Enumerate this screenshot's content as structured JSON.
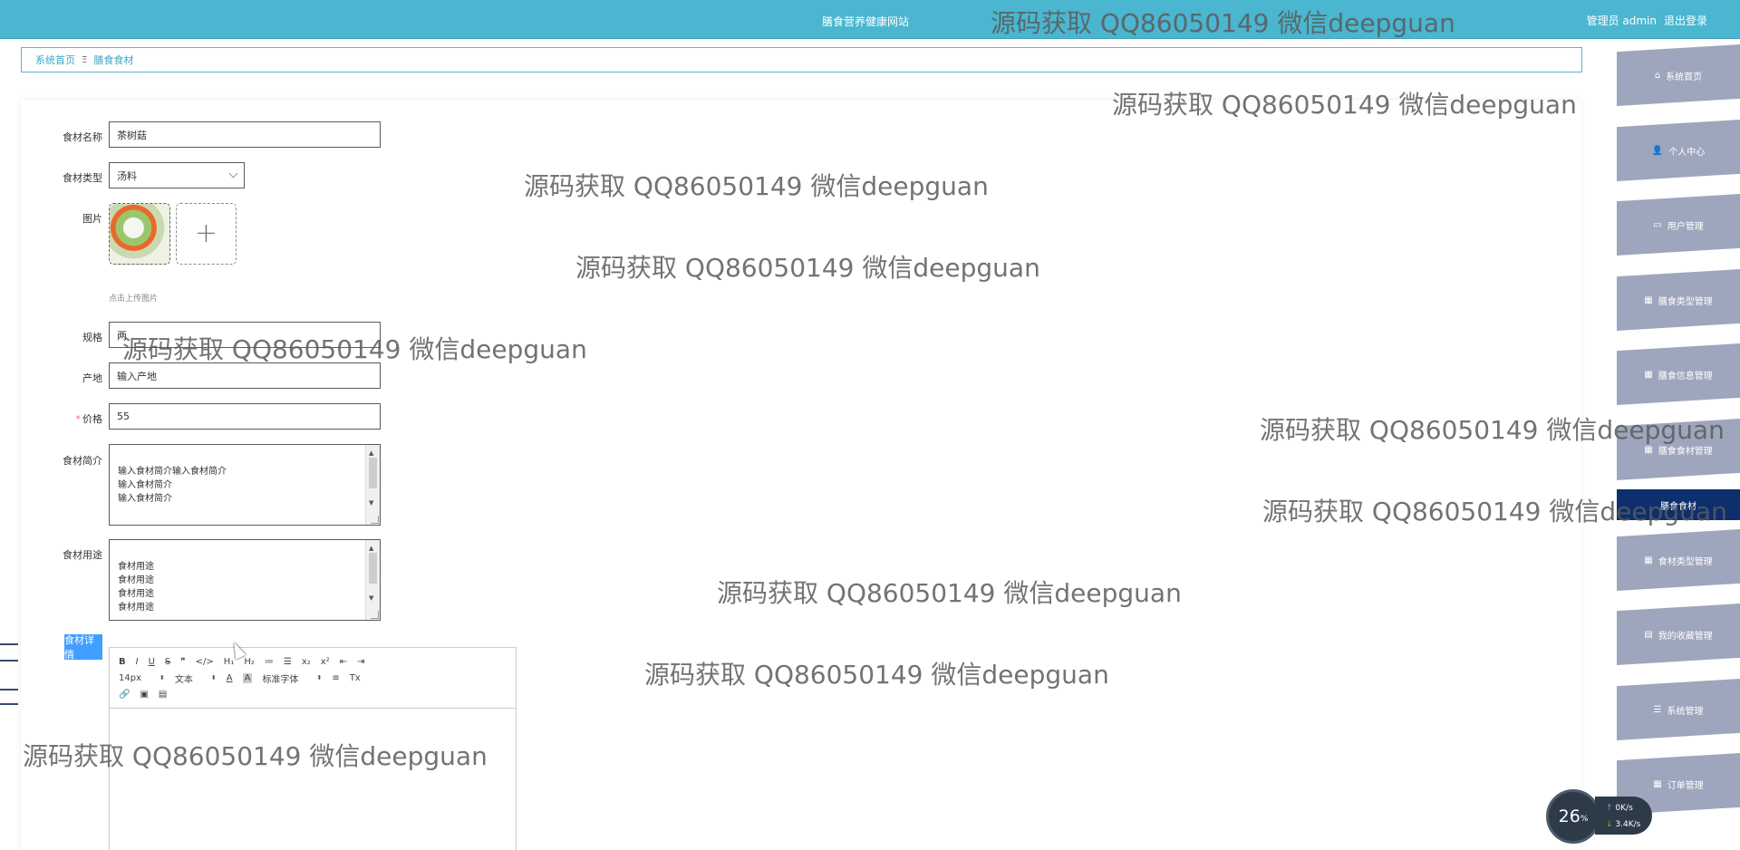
{
  "header": {
    "site_title": "膳食营养健康网站",
    "user_label": "管理员 admin",
    "logout_label": "退出登录"
  },
  "breadcrumb": {
    "home": "系统首页",
    "separator": "Ξ",
    "current": "膳食食材"
  },
  "form": {
    "name_label": "食材名称",
    "name_value": "茶树菇",
    "type_label": "食材类型",
    "type_value": "汤料",
    "image_label": "图片",
    "upload_tip": "点击上传图片",
    "spec_label": "规格",
    "spec_value": "两",
    "origin_label": "产地",
    "origin_placeholder": "输入产地",
    "price_required": "*",
    "price_label": "价格",
    "price_value": "55",
    "intro_label": "食材简介",
    "intro_value": "输入食材简介输入食材简介\n输入食材简介\n输入食材简介",
    "usage_label": "食材用途",
    "usage_value": "食材用途\n食材用途\n食材用途\n食材用途",
    "detail_label": "食材详情"
  },
  "editor": {
    "row1": [
      "B",
      "I",
      "U",
      "S",
      "❞",
      "</>",
      "H₁",
      "H₂",
      "≔",
      "☰",
      "x₂",
      "x²",
      "⇤",
      "⇥"
    ],
    "font_size": "14px",
    "text_type": "文本",
    "font_family": "标准字体",
    "color_a": "A",
    "bg_a": "A",
    "clear_format": "Tx",
    "row3": [
      "🔗",
      "▣",
      "▤"
    ]
  },
  "sidebar": {
    "items": [
      {
        "label": "系统首页",
        "icon": "⌂"
      },
      {
        "label": "个人中心",
        "icon": "👤"
      },
      {
        "label": "用户管理",
        "icon": "▭"
      },
      {
        "label": "膳食类型管理",
        "icon": "▦"
      },
      {
        "label": "膳食信息管理",
        "icon": "▦"
      },
      {
        "label": "膳食食材管理",
        "icon": "▦"
      },
      {
        "label": "膳食食材",
        "icon": ""
      },
      {
        "label": "食材类型管理",
        "icon": "▦"
      },
      {
        "label": "我的收藏管理",
        "icon": "▤"
      },
      {
        "label": "系统管理",
        "icon": "☰"
      },
      {
        "label": "订单管理",
        "icon": "▦"
      }
    ]
  },
  "network": {
    "percent": "26",
    "percent_unit": "%",
    "upload": "0",
    "upload_unit": "K/s",
    "download": "3.4",
    "download_unit": "K/s"
  },
  "watermark": "源码获取 QQ86050149 微信deepguan",
  "colors": {
    "topbar": "#4ab6d0",
    "accent": "#409eff",
    "sidebar": "#9ea6bd",
    "sidebar_active": "#0d2f6e"
  }
}
